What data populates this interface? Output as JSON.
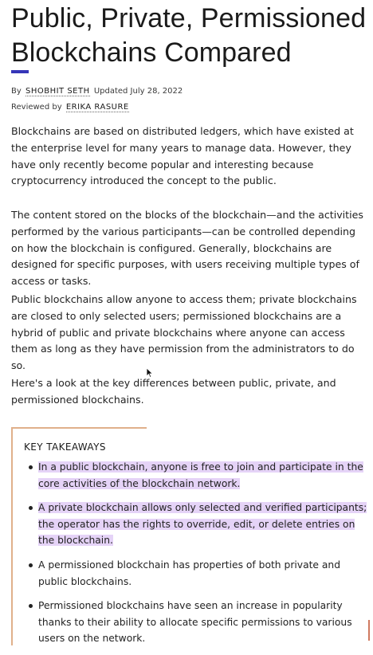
{
  "article": {
    "title": "Public, Private, Permissioned Blockchains Compared",
    "byline": {
      "by_label": "By",
      "author": "SHOBHIT SETH",
      "updated": "Updated July 28, 2022",
      "reviewed_label": "Reviewed by",
      "reviewer": "ERIKA RASURE"
    },
    "paragraphs": [
      "Blockchains are based on distributed ledgers, which have existed at the enterprise level for many years to manage data. However, they have only recently become popular and interesting because cryptocurrency introduced the concept to the public.",
      "The content stored on the blocks of the blockchain—and the activities performed by the various participants—can be controlled depending on how the blockchain is configured. Generally, blockchains are designed for specific purposes, with users receiving multiple types of access or tasks.",
      "Public blockchains allow anyone to access them; private blockchains are closed to only selected users; permissioned blockchains are a hybrid of public and private blockchains where anyone can access them as long as they have permission from the administrators to do so.",
      "Here's a look at the key differences between public, private, and permissioned blockchains."
    ]
  },
  "takeaways": {
    "heading": "KEY TAKEAWAYS",
    "items": [
      "In a public blockchain, anyone is free to join and participate in the core activities of the blockchain network.",
      "A private blockchain allows only selected and verified participants; the operator has the rights to override, edit, or delete entries on the blockchain.",
      "A permissioned blockchain has properties of both private and public blockchains.",
      "Permissioned blockchains have seen an increase in popularity thanks to their ability to allocate specific permissions to various users on the network."
    ],
    "highlighted_items": [
      0,
      1
    ],
    "highlight_color": "#e5d3f7",
    "border_color": "#e0b08b"
  },
  "colors": {
    "accent": "#3535b8"
  },
  "icons": {
    "cursor": "mouse-pointer-icon"
  }
}
